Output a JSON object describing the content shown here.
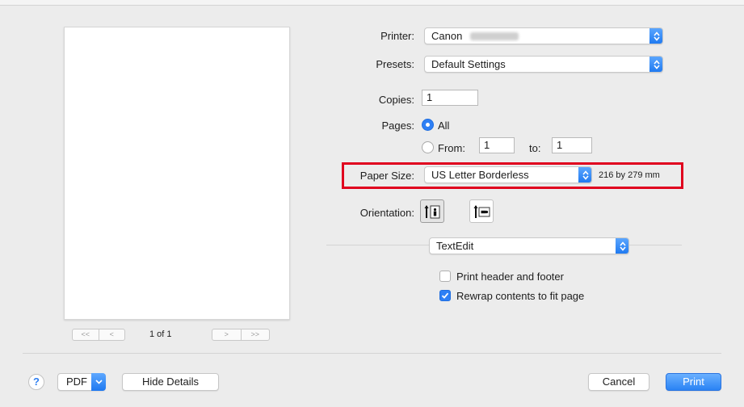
{
  "labels": {
    "printer": "Printer:",
    "presets": "Presets:",
    "copies": "Copies:",
    "pages": "Pages:",
    "paper_size": "Paper Size:",
    "orientation": "Orientation:"
  },
  "printer": {
    "value": "Canon"
  },
  "presets": {
    "value": "Default Settings"
  },
  "copies": {
    "value": "1"
  },
  "pages": {
    "all_label": "All",
    "from_label": "From:",
    "from_value": "1",
    "to_label": "to:",
    "to_value": "1",
    "selected": "All"
  },
  "paper_size": {
    "value": "US Letter Borderless",
    "dimensions": "216 by 279 mm"
  },
  "orientation": {
    "selected": "portrait",
    "icons": [
      "portrait-orientation-icon",
      "landscape-orientation-icon"
    ]
  },
  "section_popup": {
    "value": "TextEdit"
  },
  "options": [
    {
      "label": "Print header and footer",
      "checked": false
    },
    {
      "label": "Rewrap contents to fit page",
      "checked": true
    }
  ],
  "preview": {
    "first_prev": "<<",
    "prev": "<",
    "page_indicator": "1 of 1",
    "next": ">",
    "last_next": ">>"
  },
  "bottom_bar": {
    "help": "?",
    "pdf": "PDF",
    "hide_details": "Hide Details",
    "cancel": "Cancel",
    "print": "Print"
  },
  "colors": {
    "accent": "#2d7ff5",
    "highlight_box": "#e0001e",
    "background": "#ececec"
  }
}
